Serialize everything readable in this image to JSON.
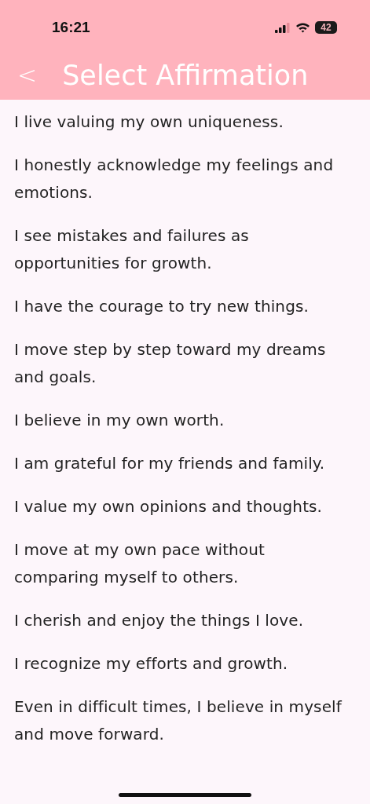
{
  "status_bar": {
    "time": "16:21",
    "battery": "42"
  },
  "header": {
    "back": "<",
    "title": "Select Affirmation"
  },
  "affirmations": [
    "I live valuing my own uniqueness.",
    "I honestly acknowledge my feelings and emotions.",
    "I see mistakes and failures as opportunities for growth.",
    "I have the courage to try new things.",
    "I move step by step toward my dreams and goals.",
    "I believe in my own worth.",
    "I am grateful for my friends and family.",
    "I value my own opinions and thoughts.",
    "I move at my own pace without comparing myself to others.",
    "I cherish and enjoy the things I love.",
    "I recognize my efforts and growth.",
    "Even in difficult times, I believe in myself and move forward."
  ]
}
